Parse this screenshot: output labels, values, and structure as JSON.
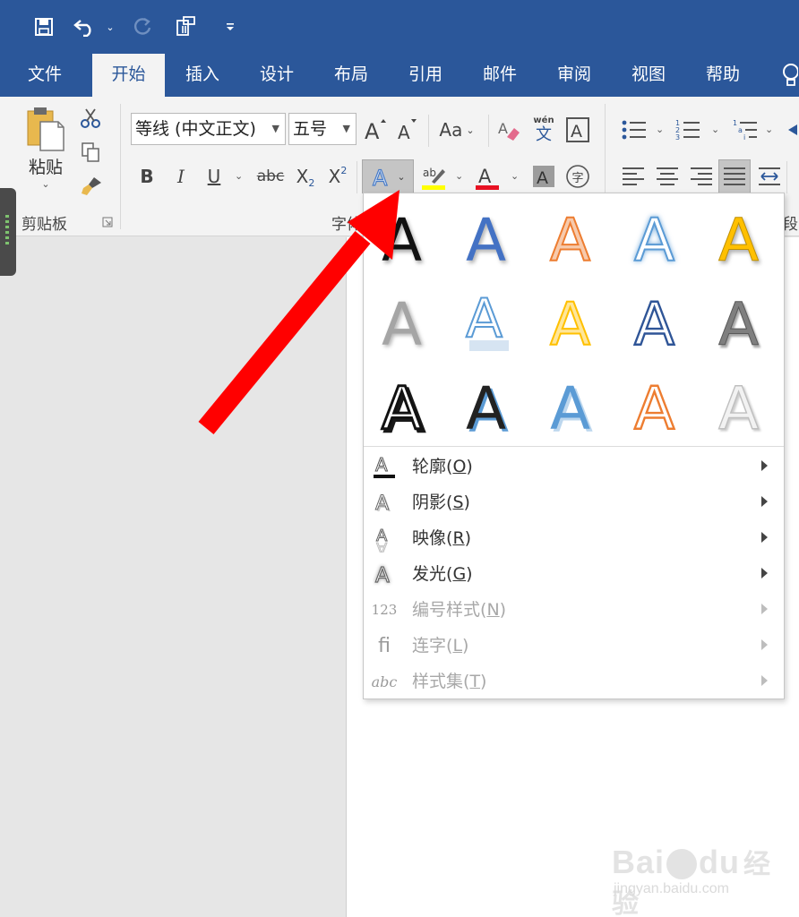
{
  "tabs": [
    "文件",
    "开始",
    "插入",
    "设计",
    "布局",
    "引用",
    "邮件",
    "审阅",
    "视图",
    "帮助"
  ],
  "active_tab": "开始",
  "clipboard": {
    "paste_label": "粘贴",
    "group_label": "剪贴板"
  },
  "font": {
    "name": "等线 (中文正文)",
    "size": "五号",
    "group_label_partial": "字体",
    "change_case_label": "Aa",
    "phonetic_label": "wén",
    "phonetic_char": "文"
  },
  "paragraph": {
    "group_label_partial": "段"
  },
  "format_buttons": {
    "bold": "B",
    "italic": "I",
    "underline": "U",
    "strikethrough": "abc",
    "subscript": "X",
    "subscript_mark": "2",
    "superscript": "X",
    "superscript_mark": "2",
    "enclose_char": "字"
  },
  "gallery_glyph": "A",
  "menu_items": [
    {
      "label": "轮廓",
      "key": "O",
      "disabled": false
    },
    {
      "label": "阴影",
      "key": "S",
      "disabled": false
    },
    {
      "label": "映像",
      "key": "R",
      "disabled": false
    },
    {
      "label": "发光",
      "key": "G",
      "disabled": false
    },
    {
      "label": "编号样式",
      "key": "N",
      "disabled": true
    },
    {
      "label": "连字",
      "key": "L",
      "disabled": true
    },
    {
      "label": "样式集",
      "key": "T",
      "disabled": true
    }
  ],
  "menu_icons": {
    "numbering": "123",
    "ligature": "fi",
    "style_set": "abc"
  },
  "watermark": {
    "brand": "Bai",
    "brand_tail": "du",
    "cn": "经验",
    "url": "jingyan.baidu.com"
  },
  "colors": {
    "title_bar": "#2b579a",
    "highlight": "#ffff00",
    "font_color": "#e81123",
    "arrow": "#ff0000"
  }
}
